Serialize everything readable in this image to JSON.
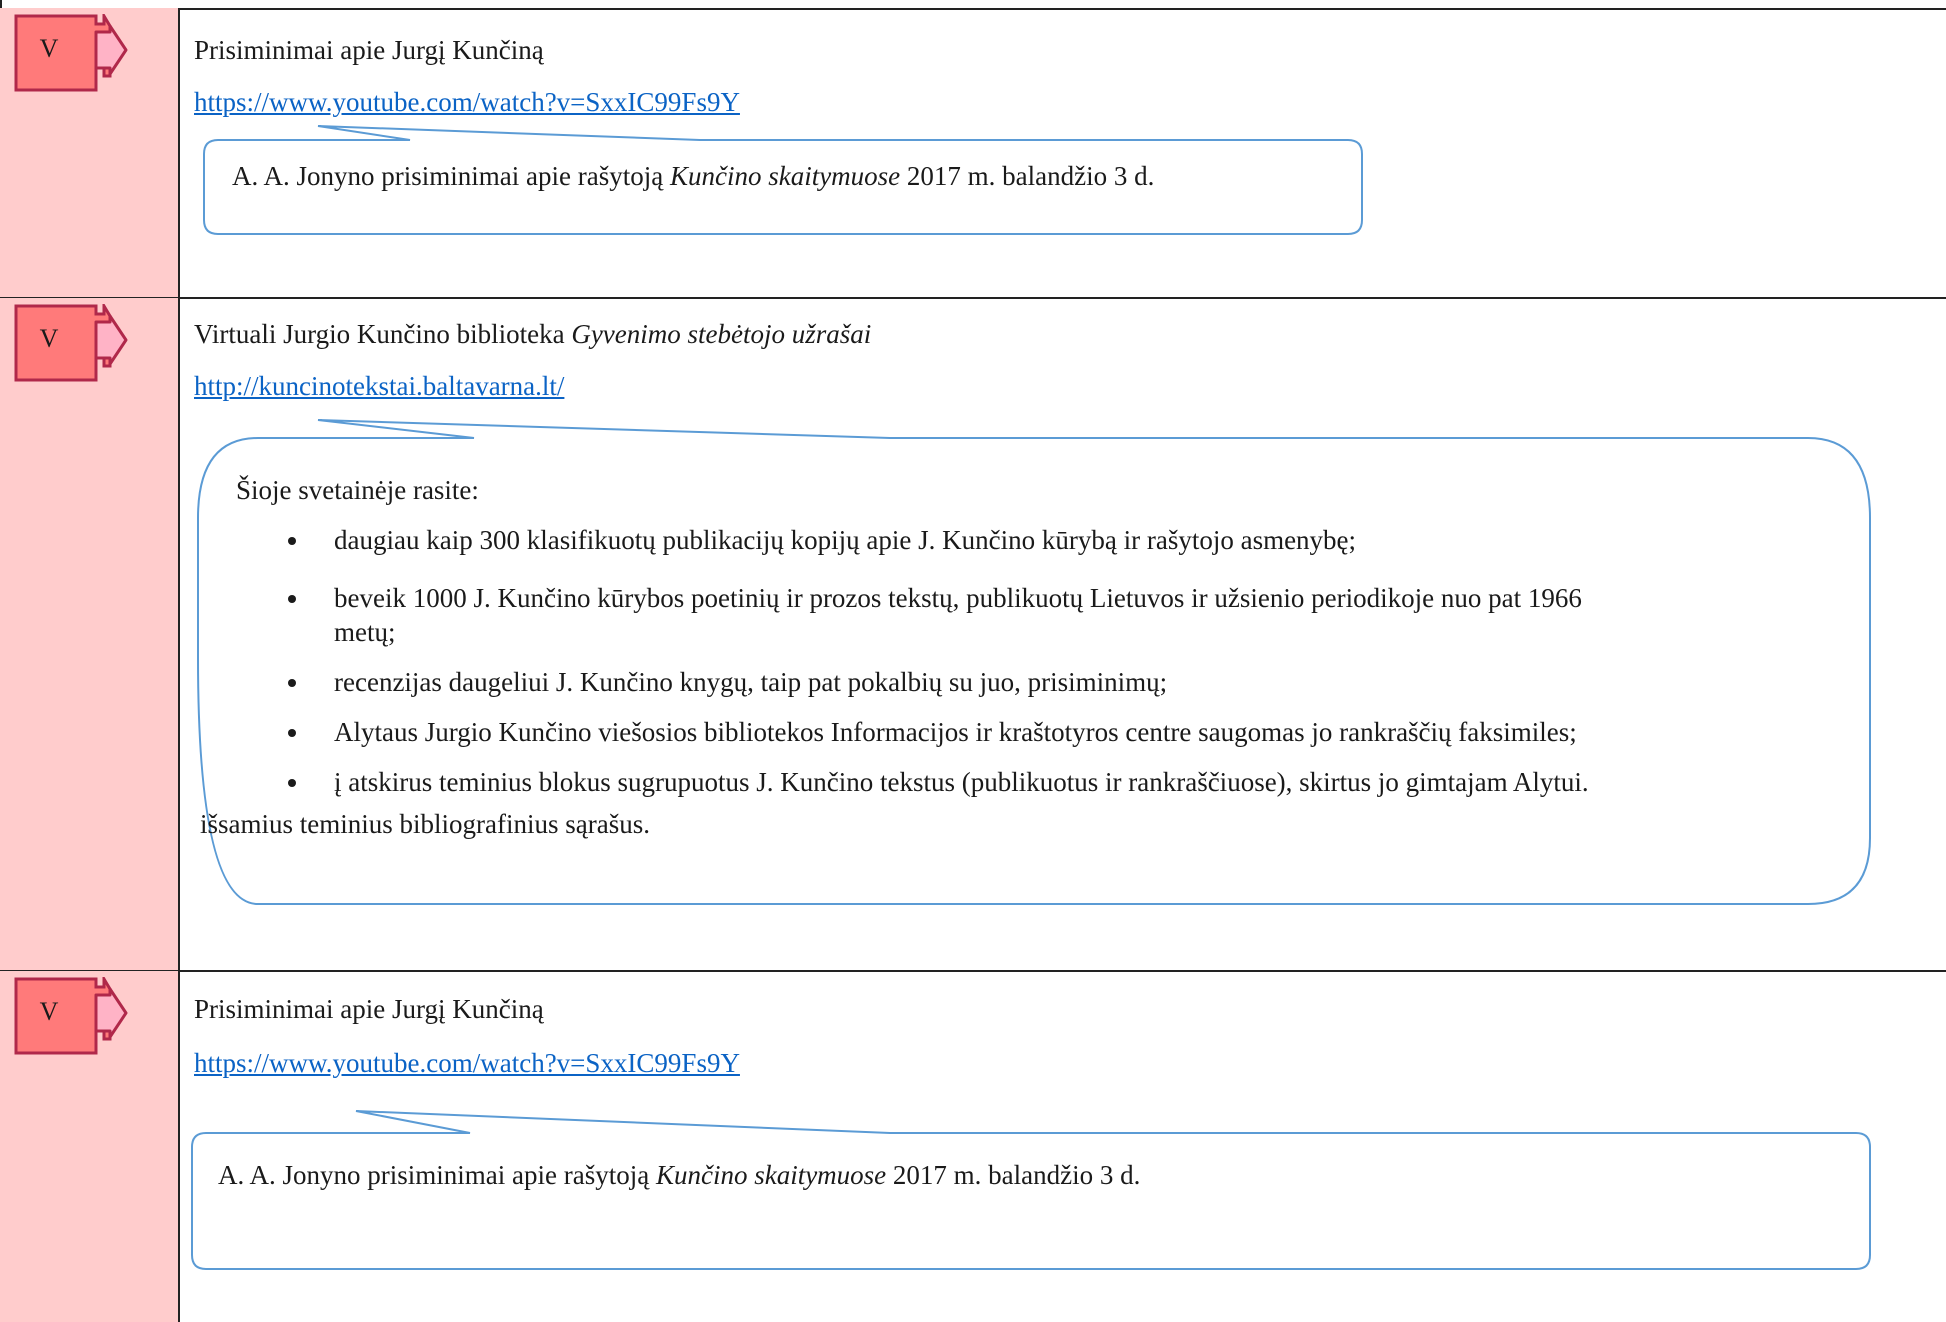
{
  "colors": {
    "left_cell": "#ffcccc",
    "marker_fill": "#ff7a7a",
    "marker_stroke": "#b0284a",
    "callout_stroke": "#5b9bd5",
    "link": "#0b63c5"
  },
  "entries": [
    {
      "marker": "V",
      "marker_icon": "right-arrow-icon",
      "title": "Prisiminimai apie Jurgį Kunčiną",
      "link": "https://www.youtube.com/watch?v=SxxIC99Fs9Y",
      "note_pre": "A. A. Jonyno prisiminimai apie rašytoją ",
      "note_em": "Kunčino skaitymuose",
      "note_post": " 2017 m. balandžio 3 d."
    },
    {
      "marker": "V",
      "marker_icon": "right-arrow-icon",
      "title_pre": "Virtuali Jurgio Kunčino biblioteka ",
      "title_em": "Gyvenimo stebėtojo užrašai",
      "link": "http://kuncinotekstai.baltavarna.lt/",
      "note_intro": "Šioje svetainėje rasite:",
      "bullets": [
        "daugiau kaip 300 klasifikuotų publikacijų kopijų apie J. Kunčino kūrybą ir rašytojo asmenybę;",
        "beveik 1000 J. Kunčino kūrybos poetinių ir prozos tekstų, publikuotų Lietuvos ir užsienio periodikoje nuo pat 1966",
        "recenzijas daugeliui J. Kunčino knygų, taip pat pokalbių su juo, prisiminimų;",
        "Alytaus Jurgio Kunčino viešosios bibliotekos Informacijos ir kraštotyros centre saugomas jo rankraščių faksimiles;",
        "į atskirus teminius blokus sugrupuotus J. Kunčino tekstus (publikuotus ir rankraščiuose), skirtus jo gimtajam Alytui."
      ],
      "bullet_2_continuation": "metų;",
      "note_tail": "išsamius teminius bibliografinius sąrašus."
    },
    {
      "marker": "V",
      "marker_icon": "right-arrow-icon",
      "title": "Prisiminimai apie Jurgį Kunčiną",
      "link": "https://www.youtube.com/watch?v=SxxIC99Fs9Y",
      "note_pre": "A. A. Jonyno prisiminimai apie rašytoją ",
      "note_em": "Kunčino skaitymuose",
      "note_post": " 2017 m. balandžio 3 d."
    }
  ]
}
